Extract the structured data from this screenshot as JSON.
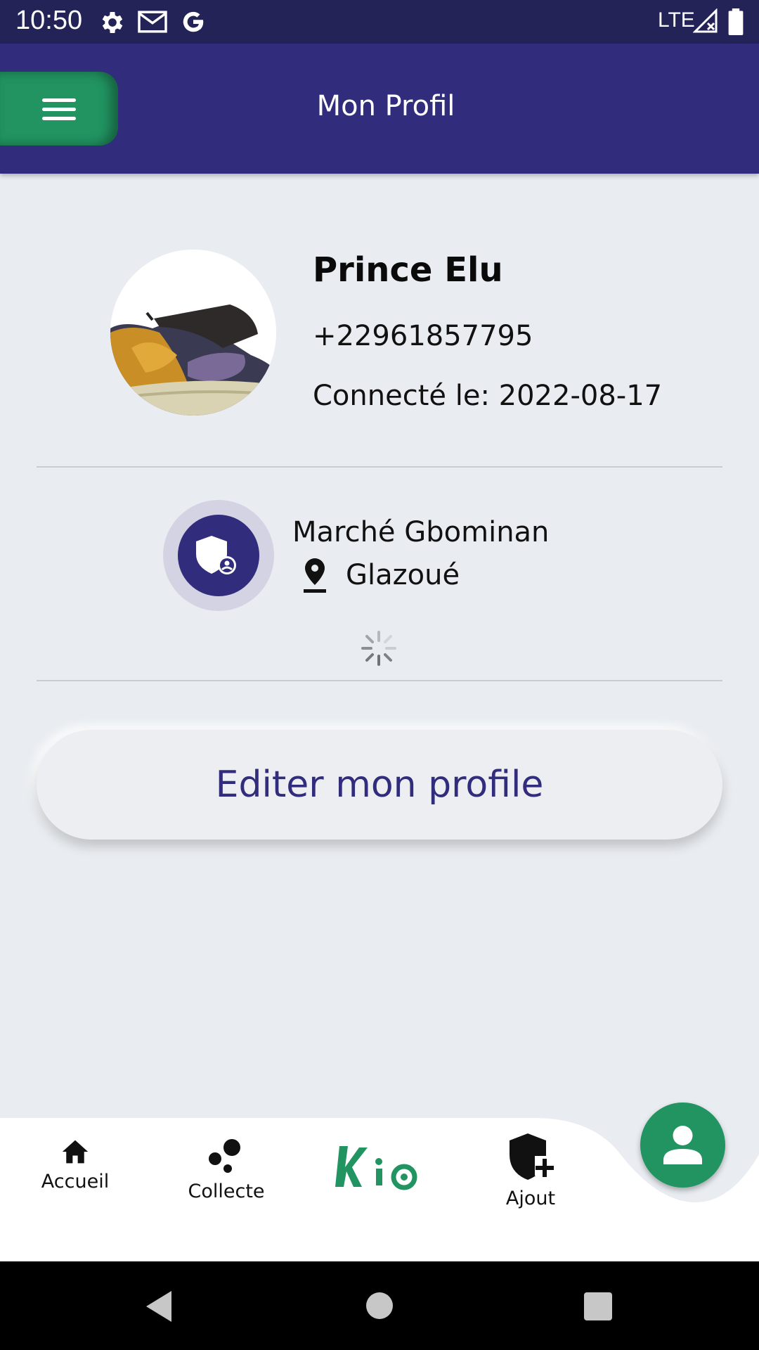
{
  "status_bar": {
    "time": "10:50",
    "network": "LTE",
    "icons": [
      "settings-icon",
      "gmail-icon",
      "google-icon",
      "signal-icon",
      "battery-icon"
    ]
  },
  "app_bar": {
    "title": "Mon Profil",
    "menu_icon": "hamburger-icon"
  },
  "profile": {
    "name": "Prince Elu",
    "phone": "+22961857795",
    "connected_label": "Connecté le: ",
    "connected_date": "2022-08-17",
    "avatar_icon": "sneaker-photo"
  },
  "market": {
    "name": "Marché Gbominan",
    "city": "Glazoué",
    "icon": "shield-user-icon",
    "location_icon": "location-pin-icon"
  },
  "edit_button": {
    "label": "Editer mon profile"
  },
  "bottom_nav": {
    "items": [
      {
        "label": "Accueil",
        "icon": "home-icon"
      },
      {
        "label": "Collecte",
        "icon": "bubbles-icon"
      },
      {
        "label": "Ki@",
        "icon": "kia-logo"
      },
      {
        "label": "Ajout",
        "icon": "shield-plus-icon"
      }
    ],
    "fab_icon": "person-icon"
  },
  "colors": {
    "primary": "#312c7c",
    "status_bar": "#242358",
    "accent_green": "#219461",
    "background": "#e9edf1"
  }
}
